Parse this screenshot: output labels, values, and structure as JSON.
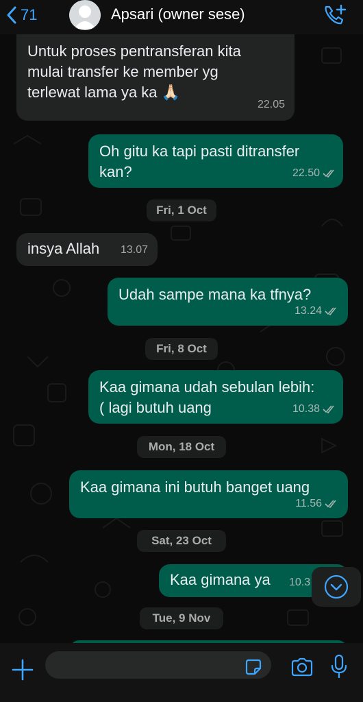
{
  "colors": {
    "accent": "#3ea6ff",
    "outgoing_bubble": "#005c4b",
    "incoming_bubble": "#222424",
    "background": "#0b0b0b"
  },
  "header": {
    "back_count": "71",
    "contact_name": "Apsari (owner sese)",
    "icons": [
      "chevron-left-icon",
      "avatar-icon",
      "add-call-icon"
    ]
  },
  "messages": [
    {
      "dir": "in",
      "text": "Untuk proses pentransferan kita\nmulai transfer ke member yg\nterlewat lama ya ka 🙏🏻",
      "time": "22.05"
    },
    {
      "dir": "out",
      "text": "Oh gitu ka tapi pasti ditransfer\nkan?",
      "time": "22.50"
    },
    {
      "dir": "in",
      "text": "insya Allah",
      "time": "13.07"
    },
    {
      "dir": "out",
      "text": "Udah sampe mana ka tfnya?",
      "time": "13.24"
    },
    {
      "dir": "out",
      "text": "Kaa gimana udah sebulan lebih:\n( lagi butuh uang",
      "time": "10.38"
    },
    {
      "dir": "out",
      "text": "Kaa gimana ini butuh banget uang",
      "time": "11.56"
    },
    {
      "dir": "out",
      "text": "Kaa gimana ya",
      "time": "10.3"
    }
  ],
  "dates": [
    "Fri, 1 Oct",
    "Fri, 8 Oct",
    "Mon, 18 Oct",
    "Sat, 23 Oct",
    "Tue, 9 Nov"
  ],
  "input": {
    "placeholder": "",
    "icons": [
      "plus-icon",
      "sticker-icon",
      "camera-icon",
      "microphone-icon",
      "scroll-down-icon"
    ]
  }
}
